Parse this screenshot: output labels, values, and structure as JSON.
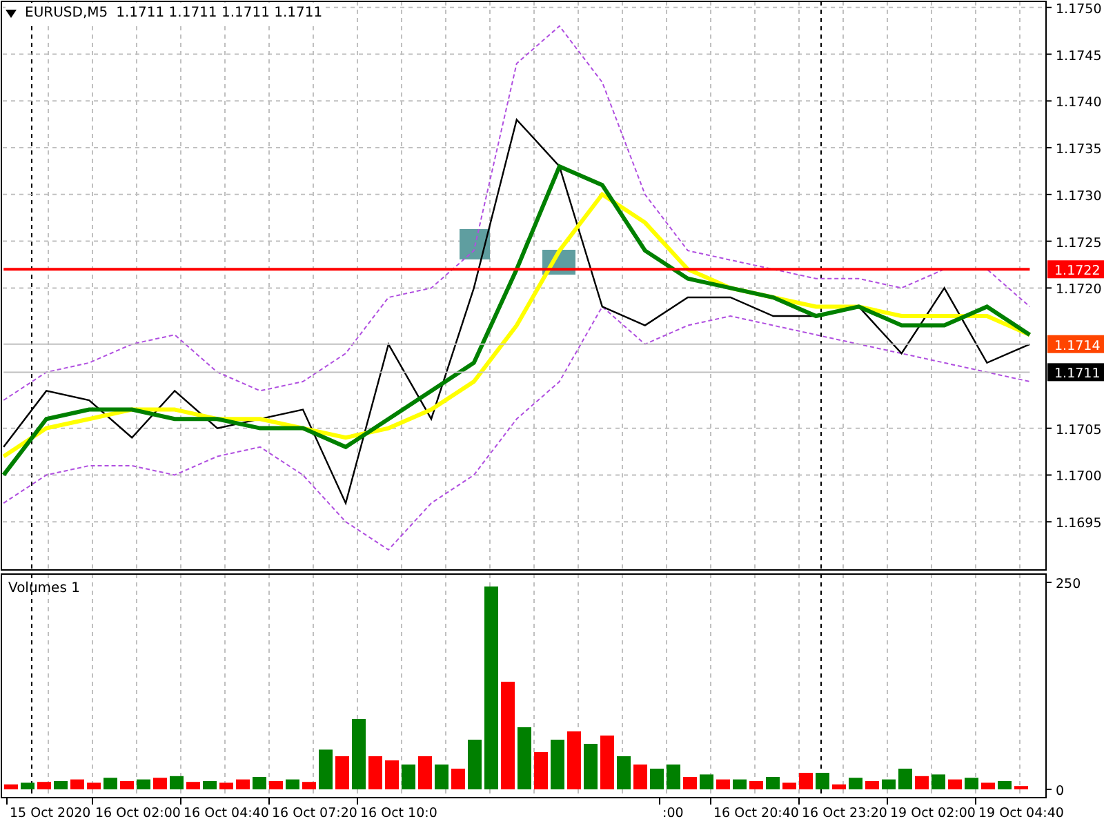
{
  "header": {
    "symbol": "EURUSD,M5",
    "quote": "1.1711 1.1711 1.1711 1.1711"
  },
  "price_chart": {
    "chart_data": {
      "type": "line",
      "categories": [
        null,
        null,
        null,
        null,
        null,
        null,
        null,
        null,
        null,
        null,
        null,
        null,
        null,
        null,
        null,
        null,
        null,
        null,
        null,
        null,
        null,
        null,
        null,
        null,
        null
      ],
      "ylim": [
        1.169,
        1.17505
      ],
      "grid": true,
      "yticks": [
        {
          "value": 1.175,
          "label": "1.1750"
        },
        {
          "value": 1.1745,
          "label": "1.1745"
        },
        {
          "value": 1.174,
          "label": "1.1740"
        },
        {
          "value": 1.1735,
          "label": "1.1735"
        },
        {
          "value": 1.173,
          "label": "1.1730"
        },
        {
          "value": 1.1725,
          "label": "1.1725"
        },
        {
          "value": 1.172,
          "label": "1.1720"
        },
        {
          "value": 1.1705,
          "label": "1.1705"
        },
        {
          "value": 1.17,
          "label": "1.1700"
        },
        {
          "value": 1.1695,
          "label": "1.1695"
        }
      ],
      "series": [
        {
          "color": "#b04fe0",
          "line_style": "dashed",
          "values": [
            1.1708,
            1.1711,
            1.1712,
            1.1714,
            1.1715,
            1.1711,
            1.1709,
            1.171,
            1.1713,
            1.1719,
            1.172,
            1.1724,
            1.1744,
            1.1748,
            1.1742,
            1.173,
            1.1724,
            1.1723,
            1.1722,
            1.1721,
            1.1721,
            1.172,
            1.1722,
            1.1722,
            1.1718
          ]
        },
        {
          "color": "#b04fe0",
          "line_style": "dashed",
          "values": [
            1.1697,
            1.17,
            1.1701,
            1.1701,
            1.17,
            1.1702,
            1.1703,
            1.17,
            1.1695,
            1.1692,
            1.1697,
            1.17,
            1.1706,
            1.171,
            1.1718,
            1.1714,
            1.1716,
            1.1717,
            1.1716,
            1.1715,
            1.1714,
            1.1713,
            1.1712,
            1.1711,
            1.171
          ]
        },
        {
          "color": "#000000",
          "line_style": "solid",
          "values": [
            1.1703,
            1.1709,
            1.1708,
            1.1704,
            1.1709,
            1.1705,
            1.1706,
            1.1707,
            1.1697,
            1.1714,
            1.1706,
            1.172,
            1.1738,
            1.1733,
            1.1718,
            1.1716,
            1.1719,
            1.1719,
            1.1717,
            1.1717,
            1.1718,
            1.1713,
            1.172,
            1.1712,
            1.1714
          ]
        },
        {
          "color": "#ffff00",
          "line_style": "solid",
          "values": [
            1.1702,
            1.1705,
            1.1706,
            1.1707,
            1.1707,
            1.1706,
            1.1706,
            1.1705,
            1.1704,
            1.1705,
            1.1707,
            1.171,
            1.1716,
            1.1724,
            1.173,
            1.1727,
            1.1722,
            1.172,
            1.1719,
            1.1718,
            1.1718,
            1.1717,
            1.1717,
            1.1717,
            1.1715
          ]
        },
        {
          "color": "#008000",
          "line_style": "solid",
          "values": [
            1.17,
            1.1706,
            1.1707,
            1.1707,
            1.1706,
            1.1706,
            1.1705,
            1.1705,
            1.1703,
            1.1706,
            1.1709,
            1.1712,
            1.1722,
            1.1733,
            1.1731,
            1.1724,
            1.1721,
            1.172,
            1.1719,
            1.1717,
            1.1718,
            1.1716,
            1.1716,
            1.1718,
            1.1715
          ]
        },
        {
          "color": "#ff0000",
          "line_style": "solid",
          "values": [
            1.1722,
            1.1722,
            1.1722,
            1.1722,
            1.1722,
            1.1722,
            1.1722,
            1.1722,
            1.1722,
            1.1722,
            1.1722,
            1.1722,
            1.1722,
            1.1722,
            1.1722,
            1.1722,
            1.1722,
            1.1722,
            1.1722,
            1.1722,
            1.1722,
            1.1722,
            1.1722,
            1.1722,
            1.1722
          ]
        },
        {
          "color": "#c0c0c0",
          "line_style": "solid",
          "values": [
            1.1714,
            1.1714,
            1.1714,
            1.1714,
            1.1714,
            1.1714,
            1.1714,
            1.1714,
            1.1714,
            1.1714,
            1.1714,
            1.1714,
            1.1714,
            1.1714,
            1.1714,
            1.1714,
            1.1714,
            1.1714,
            1.1714,
            1.1714,
            1.1714,
            1.1714,
            1.1714,
            1.1714,
            1.1714
          ]
        },
        {
          "color": "#c0c0c0",
          "line_style": "solid",
          "values": [
            1.1711,
            1.1711,
            1.1711,
            1.1711,
            1.1711,
            1.1711,
            1.1711,
            1.1711,
            1.1711,
            1.1711,
            1.1711,
            1.1711,
            1.1711,
            1.1711,
            1.1711,
            1.1711,
            1.1711,
            1.1711,
            1.1711,
            1.1711,
            1.1711,
            1.1711,
            1.1711,
            1.1711,
            1.1711
          ]
        }
      ]
    },
    "badges": [
      {
        "text": "1.1722",
        "color": "#ff0000"
      },
      {
        "text": "1.1714",
        "color": "#ff4500"
      },
      {
        "text": "1.1711",
        "color": "#000000"
      }
    ]
  },
  "volume_chart": {
    "title": "Volumes 1",
    "chart_data": {
      "type": "bar",
      "categories": [
        null,
        null,
        null,
        null,
        null,
        null,
        null,
        null,
        null,
        null,
        null,
        null,
        null,
        null,
        null,
        null,
        null,
        null,
        null,
        null,
        null,
        null,
        null,
        null,
        null,
        null,
        null,
        null,
        null,
        null,
        null,
        null,
        null,
        null,
        null,
        null,
        null,
        null,
        null,
        null,
        null,
        null,
        null,
        null,
        null,
        null,
        null,
        null,
        null,
        null,
        null,
        null,
        null,
        null,
        null,
        null,
        null,
        null,
        null,
        null,
        null,
        null
      ],
      "ylim": [
        0,
        260
      ],
      "grid": true,
      "stacked": true,
      "yticks": [
        {
          "value": 250,
          "label": "250"
        },
        {
          "value": 0,
          "label": "0"
        }
      ],
      "series": [
        {
          "color": "#008000",
          "values": [
            0,
            8,
            0,
            10,
            0,
            0,
            14,
            0,
            12,
            0,
            16,
            0,
            10,
            0,
            0,
            15,
            0,
            12,
            0,
            48,
            0,
            85,
            0,
            0,
            30,
            0,
            30,
            0,
            60,
            245,
            0,
            75,
            0,
            60,
            0,
            55,
            0,
            40,
            0,
            25,
            30,
            0,
            18,
            0,
            12,
            0,
            15,
            0,
            0,
            20,
            0,
            14,
            0,
            12,
            25,
            0,
            18,
            0,
            14,
            0,
            10,
            0
          ]
        },
        {
          "color": "#ff0000",
          "values": [
            6,
            0,
            9,
            0,
            12,
            8,
            0,
            10,
            0,
            14,
            0,
            9,
            0,
            8,
            12,
            0,
            10,
            0,
            9,
            0,
            40,
            0,
            40,
            35,
            0,
            40,
            0,
            25,
            0,
            0,
            130,
            0,
            45,
            0,
            70,
            0,
            65,
            0,
            30,
            0,
            0,
            15,
            0,
            12,
            0,
            10,
            0,
            8,
            20,
            0,
            6,
            0,
            10,
            0,
            0,
            16,
            0,
            12,
            0,
            8,
            0,
            4
          ]
        }
      ]
    }
  },
  "time_axis": [
    "15 Oct 2020",
    "16 Oct 02:00",
    "16 Oct 04:40",
    "16 Oct 07:20",
    "16 Oct 10:0",
    ":00",
    "16 Oct 20:40",
    "16 Oct 23:20",
    "19 Oct 02:00",
    "19 Oct 04:40"
  ]
}
